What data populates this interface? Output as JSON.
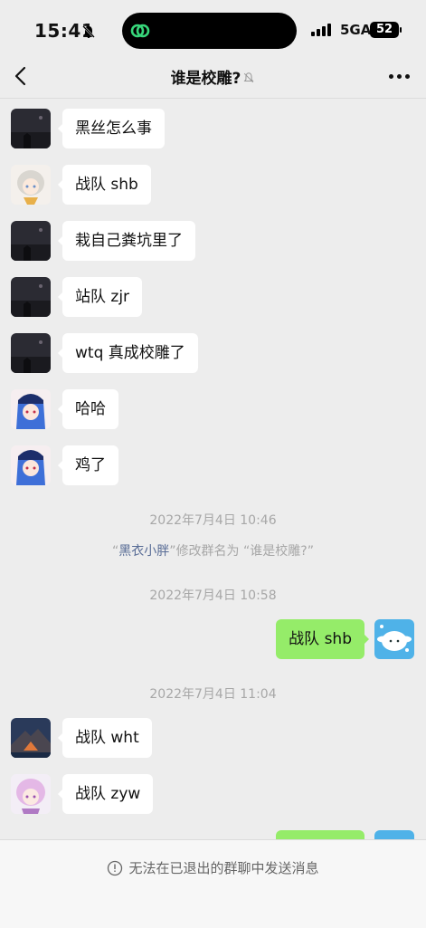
{
  "status_bar": {
    "time": "15:41",
    "network": "5GA",
    "battery": "52"
  },
  "nav": {
    "title": "谁是校雕?"
  },
  "messages": [
    {
      "side": "left",
      "avatar": "night-sky",
      "text": "黑丝怎么事"
    },
    {
      "side": "left",
      "avatar": "anime-silver",
      "text": "战队 shb"
    },
    {
      "side": "left",
      "avatar": "night-sky",
      "text": "栽自己粪坑里了"
    },
    {
      "side": "left",
      "avatar": "night-sky",
      "text": "站队 zjr"
    },
    {
      "side": "left",
      "avatar": "night-sky",
      "text": "wtq 真成校雕了"
    },
    {
      "side": "left",
      "avatar": "anime-blue",
      "text": "哈哈"
    },
    {
      "side": "left",
      "avatar": "anime-blue",
      "text": "鸡了"
    }
  ],
  "timestamps": [
    "2022年7月4日 10:46",
    "2022年7月4日 10:58",
    "2022年7月4日 11:04"
  ],
  "system_message": {
    "quote_open": "“",
    "who": "黑衣小胖",
    "quote_close": "”",
    "action": "修改群名为 “谁是校雕?”"
  },
  "messages_after": [
    {
      "side": "right",
      "avatar": "cinnamoroll",
      "text": "战队 shb"
    },
    {
      "side": "left",
      "avatar": "volcano",
      "text": "战队 wht"
    },
    {
      "side": "left",
      "avatar": "anime-pink",
      "text": "战队 zyw"
    },
    {
      "side": "right",
      "avatar": "cinnamoroll",
      "text": ""
    }
  ],
  "footer": {
    "notice": "无法在已退出的群聊中发送消息"
  },
  "colors": {
    "background": "#ededed",
    "bubble_self": "#95ec69",
    "bubble_other": "#ffffff",
    "link": "#576b95"
  }
}
